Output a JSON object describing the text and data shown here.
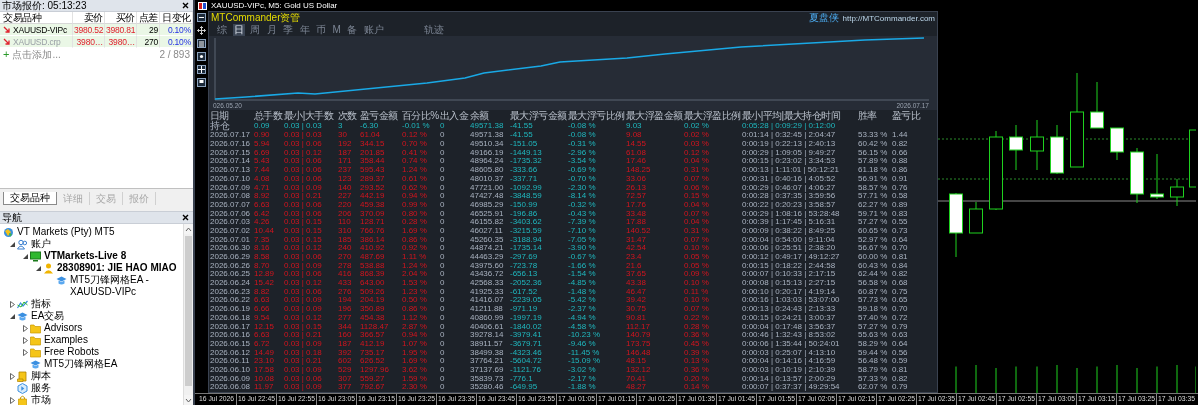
{
  "market_watch": {
    "title": "市场报价: 05:13:23",
    "columns": [
      "交易品种",
      "卖价",
      "买价",
      "点差",
      "日变化"
    ],
    "rows": [
      {
        "symbol": "XAUUSD-VIPc",
        "bid": "3980.52",
        "ask": "3980.81",
        "spread": "29",
        "change": "0.10%",
        "inactive": false
      },
      {
        "symbol": "XAUUSD.crp",
        "bid": "3980…",
        "ask": "3980…",
        "spread": "270",
        "change": "0.10%",
        "inactive": true
      }
    ],
    "add_icon": "+",
    "add_label": "点击添加...",
    "count": "2 / 893",
    "tabs": [
      {
        "label": "交易品种",
        "selected": true
      },
      {
        "label": "详细",
        "selected": false
      },
      {
        "label": "交易",
        "selected": false
      },
      {
        "label": "报价",
        "selected": false
      }
    ]
  },
  "navigator": {
    "title": "导航",
    "tree": [
      {
        "label": "VT Markets (Pty) MT5",
        "kind": "broker",
        "children": [
          {
            "label": "账户",
            "kind": "accounts",
            "expanded": true,
            "children": [
              {
                "label": "VTMarkets-Live 8",
                "kind": "server",
                "expanded": true,
                "children": [
                  {
                    "label": "28308901: JIE HAO MIAO",
                    "kind": "account",
                    "expanded": true,
                    "children": [
                      {
                        "label": "MT5刀锋网格EA - XAUUSD-VIPc",
                        "kind": "expert"
                      }
                    ]
                  }
                ]
              }
            ]
          },
          {
            "label": "指标",
            "kind": "indicators",
            "expanded": false
          },
          {
            "label": "EA交易",
            "kind": "experts",
            "expanded": true,
            "children": [
              {
                "label": "Advisors",
                "kind": "folder",
                "expanded": false
              },
              {
                "label": "Examples",
                "kind": "folder",
                "expanded": false
              },
              {
                "label": "Free Robots",
                "kind": "folder",
                "expanded": false
              },
              {
                "label": "MT5刀锋网格EA",
                "kind": "expert"
              }
            ]
          },
          {
            "label": "脚本",
            "kind": "scripts",
            "expanded": false
          },
          {
            "label": "服务",
            "kind": "services"
          },
          {
            "label": "市场",
            "kind": "market",
            "expanded": false
          }
        ]
      }
    ]
  },
  "chart_window": {
    "title": "XAUUSD-VIPc, M5: Gold US Dollar",
    "time_axis": [
      "16 Jul 2026",
      "16 Jul 22:45",
      "16 Jul 22:55",
      "16 Jul 23:05",
      "16 Jul 23:15",
      "16 Jul 23:25",
      "16 Jul 23:35",
      "16 Jul 23:45",
      "16 Jul 23:55",
      "17 Jul 01:05",
      "17 Jul 01:15",
      "17 Jul 01:25",
      "17 Jul 01:35",
      "17 Jul 01:45",
      "17 Jul 01:55",
      "17 Jul 02:05",
      "17 Jul 02:15",
      "17 Jul 02:25",
      "17 Jul 02:35",
      "17 Jul 02:45",
      "17 Jul 02:55",
      "17 Jul 03:05",
      "17 Jul 03:15",
      "17 Jul 03:25",
      "17 Jul 03:35"
    ]
  },
  "mt_commander": {
    "title": "MTCommander资管",
    "brand": "夏盘侠",
    "url": "http://MTCommander.com",
    "tabs": [
      {
        "label": "综",
        "selected": false
      },
      {
        "label": "日",
        "selected": true
      },
      {
        "label": "周",
        "selected": false
      },
      {
        "label": "月",
        "selected": false
      },
      {
        "label": "季",
        "selected": false
      },
      {
        "label": "年",
        "selected": false
      },
      {
        "label": "币",
        "selected": false
      },
      {
        "label": "M",
        "selected": false
      },
      {
        "label": "备",
        "selected": false
      },
      {
        "label": "账户",
        "selected": false
      }
    ],
    "extra_tabs": [
      {
        "label": "轨迹",
        "selected": false
      }
    ],
    "equity_curve": {
      "start_label": "026.05.20",
      "end_label": "2026.07.17"
    },
    "table": {
      "columns": [
        "日期",
        "总手数",
        "最小|大手数",
        "次数",
        "盈亏金额",
        "百分比%",
        "出入金",
        "余额",
        "最大浮亏金额",
        "最大浮亏比例",
        "最大浮盈金额",
        "最大浮盈比例",
        "最小|平均|最大持仓时间",
        "胜率",
        "盈亏比"
      ],
      "rows": [
        {
          "kind": "position",
          "cells": [
            "持仓",
            "0.09",
            "0.03 | 0.03",
            "3",
            "-6.30",
            "-0.01 %",
            "0",
            "49571.38",
            "-41.55",
            "-0.08 %",
            "9.03",
            "0.02 %",
            "0:05:28 | 0:09:29 | 0:12:00"
          ]
        },
        {
          "kind": "day",
          "cells": [
            "2026.07.17",
            "0.90",
            "0.03 | 0.03",
            "30",
            "61.04",
            "0.12 %",
            "0",
            "49571.38",
            "-41.55",
            "-0.08 %",
            "9.08",
            "0.02 %",
            "0:01:14 | 0:32:45 | 2:04:47",
            "53.33 %",
            "1.44"
          ]
        },
        {
          "kind": "day",
          "cells": [
            "2026.07.16",
            "5.94",
            "0.03 | 0.06",
            "192",
            "344.15",
            "0.70 %",
            "0",
            "49510.34",
            "-151.05",
            "-0.31 %",
            "14.55",
            "0.03 %",
            "0:00:19 | 0:22:13 | 2:40:13",
            "60.42 %",
            "0.82"
          ]
        },
        {
          "kind": "day",
          "cells": [
            "2026.07.15",
            "6.69",
            "0.03 | 0.12",
            "187",
            "201.85",
            "0.41 %",
            "0",
            "49166.19",
            "-1449.13",
            "-2.96 %",
            "61.08",
            "0.12 %",
            "0:00:29 | 1:09:05 | 9:49:27",
            "56.15 %",
            "0.66"
          ]
        },
        {
          "kind": "day",
          "cells": [
            "2026.07.14",
            "5.43",
            "0.03 | 0.06",
            "171",
            "358.44",
            "0.74 %",
            "0",
            "48964.24",
            "-1735.32",
            "-3.54 %",
            "17.46",
            "0.04 %",
            "0:00:15 | 0:23:02 | 3:34:53",
            "57.89 %",
            "0.88"
          ]
        },
        {
          "kind": "day",
          "cells": [
            "2026.07.13",
            "7.44",
            "0.03 | 0.06",
            "237",
            "595.43",
            "1.24 %",
            "0",
            "48605.80",
            "-333.66",
            "-0.69 %",
            "148.25",
            "0.31 %",
            "0:00:13 | 1:11:01 | 50:12:21",
            "61.18 %",
            "0.86"
          ]
        },
        {
          "kind": "day",
          "cells": [
            "2026.07.10",
            "4.08",
            "0.03 | 0.06",
            "123",
            "289.37",
            "0.61 %",
            "0",
            "48010.37",
            "-337.71",
            "-0.70 %",
            "33.06",
            "0.07 %",
            "0:00:31 | 0:40:16 | 4:05:52",
            "56.91 %",
            "0.91"
          ]
        },
        {
          "kind": "day",
          "cells": [
            "2026.07.09",
            "4.71",
            "0.03 | 0.09",
            "140",
            "293.52",
            "0.62 %",
            "0",
            "47721.00",
            "-1092.99",
            "-2.30 %",
            "26.13",
            "0.06 %",
            "0:00:29 | 0:46:07 | 4:06:27",
            "58.57 %",
            "0.76"
          ]
        },
        {
          "kind": "day",
          "cells": [
            "2026.07.08",
            "8.92",
            "0.03 | 0.21",
            "227",
            "442.19",
            "0.94 %",
            "0",
            "47427.48",
            "-3848.59",
            "-8.14 %",
            "72.57",
            "0.15 %",
            "0:00:28 | 0:37:35 | 3:59:56",
            "57.71 %",
            "0.58"
          ]
        },
        {
          "kind": "day",
          "cells": [
            "2026.07.07",
            "6.63",
            "0.03 | 0.06",
            "220",
            "459.38",
            "0.99 %",
            "0",
            "46985.29",
            "-150.99",
            "-0.32 %",
            "17.76",
            "0.04 %",
            "0:00:22 | 0:20:23 | 3:58:57",
            "62.27 %",
            "0.89"
          ]
        },
        {
          "kind": "day",
          "cells": [
            "2026.07.06",
            "6.42",
            "0.03 | 0.06",
            "206",
            "370.09",
            "0.80 %",
            "0",
            "46525.91",
            "-196.86",
            "-0.43 %",
            "33.48",
            "0.07 %",
            "0:00:29 | 1:08:16 | 53:28:48",
            "59.71 %",
            "0.83"
          ]
        },
        {
          "kind": "day",
          "cells": [
            "2026.07.03",
            "4.26",
            "0.03 | 0.15",
            "110",
            "128.71",
            "0.28 %",
            "0",
            "46155.82",
            "-3403.62",
            "-7.39 %",
            "17.88",
            "0.04 %",
            "0:00:39 | 1:17:45 | 5:16:31",
            "57.27 %",
            "0.55"
          ]
        },
        {
          "kind": "day",
          "cells": [
            "2026.07.02",
            "10.44",
            "0.03 | 0.15",
            "310",
            "766.76",
            "1.69 %",
            "0",
            "46027.11",
            "-3215.59",
            "-7.10 %",
            "140.52",
            "0.31 %",
            "0:00:09 | 0:38:22 | 8:49:25",
            "60.65 %",
            "0.73"
          ]
        },
        {
          "kind": "day",
          "cells": [
            "2026.07.01",
            "7.35",
            "0.03 | 0.15",
            "185",
            "386.14",
            "0.86 %",
            "0",
            "45260.35",
            "-3188.94",
            "-7.05 %",
            "31.47",
            "0.07 %",
            "0:00:04 | 0:54:00 | 9:11:04",
            "52.97 %",
            "0.64"
          ]
        },
        {
          "kind": "day",
          "cells": [
            "2026.06.30",
            "8.16",
            "0.03 | 0.12",
            "240",
            "410.92",
            "0.92 %",
            "0",
            "44874.21",
            "-1735.14",
            "-3.90 %",
            "42.54",
            "0.10 %",
            "0:00:06 | 0:25:51 | 2:38:20",
            "56.67 %",
            "0.70"
          ]
        },
        {
          "kind": "day",
          "cells": [
            "2026.06.29",
            "8.58",
            "0.03 | 0.06",
            "270",
            "487.69",
            "1.11 %",
            "0",
            "44463.29",
            "-297.69",
            "-0.67 %",
            "23.4",
            "0.05 %",
            "0:00:12 | 0:49:17 | 49:12:27",
            "60.00 %",
            "0.81"
          ]
        },
        {
          "kind": "day",
          "cells": [
            "2026.06.26",
            "8.70",
            "0.03 | 0.09",
            "278",
            "538.88",
            "1.24 %",
            "0",
            "43975.60",
            "-723.78",
            "-1.66 %",
            "21.6",
            "0.05 %",
            "0:00:15 | 0:18:22 | 2:44:58",
            "60.43 %",
            "0.84"
          ]
        },
        {
          "kind": "day",
          "cells": [
            "2026.06.25",
            "12.89",
            "0.03 | 0.06",
            "416",
            "868.39",
            "2.04 %",
            "0",
            "43436.72",
            "-656.13",
            "-1.54 %",
            "37.65",
            "0.09 %",
            "0:00:07 | 0:10:33 | 2:17:15",
            "62.44 %",
            "0.82"
          ]
        },
        {
          "kind": "day",
          "cells": [
            "2026.06.24",
            "15.42",
            "0.03 | 0.12",
            "433",
            "643.00",
            "1.53 %",
            "0",
            "42568.33",
            "-2052.36",
            "-4.85 %",
            "43.38",
            "0.10 %",
            "0:00:08 | 0:15:13 | 2:27:15",
            "56.58 %",
            "0.68"
          ]
        },
        {
          "kind": "day",
          "cells": [
            "2026.06.23",
            "8.82",
            "0.03 | 0.06",
            "276",
            "509.26",
            "1.23 %",
            "0",
            "41925.33",
            "-617.52",
            "-1.48 %",
            "46.47",
            "0.11 %",
            "0:00:10 | 0:20:17 | 4:19:14",
            "60.87 %",
            "0.75"
          ]
        },
        {
          "kind": "day",
          "cells": [
            "2026.06.22",
            "6.63",
            "0.03 | 0.09",
            "194",
            "204.19",
            "0.50 %",
            "0",
            "41416.07",
            "-2239.05",
            "-5.42 %",
            "39.42",
            "0.10 %",
            "0:00:16 | 1:03:03 | 53:07:00",
            "57.73 %",
            "0.65"
          ]
        },
        {
          "kind": "day",
          "cells": [
            "2026.06.19",
            "6.66",
            "0.03 | 0.09",
            "196",
            "350.89",
            "0.86 %",
            "0",
            "41211.88",
            "-971.19",
            "-2.37 %",
            "30.75",
            "0.07 %",
            "0:00:13 | 0:24:43 | 2:13:33",
            "59.18 %",
            "0.70"
          ]
        },
        {
          "kind": "day",
          "cells": [
            "2026.06.18",
            "9.54",
            "0.03 | 0.12",
            "277",
            "454.38",
            "1.12 %",
            "0",
            "40860.99",
            "-1997.19",
            "-4.94 %",
            "90.81",
            "0.22 %",
            "0:00:15 | 0:24:21 | 3:00:37",
            "57.40 %",
            "0.72"
          ]
        },
        {
          "kind": "day",
          "cells": [
            "2026.06.17",
            "12.15",
            "0.03 | 0.15",
            "344",
            "1128.47",
            "2.87 %",
            "0",
            "40406.61",
            "-1840.02",
            "-4.58 %",
            "112.17",
            "0.28 %",
            "0:00:04 | 0:17:48 | 3:56:37",
            "57.27 %",
            "0.79"
          ]
        },
        {
          "kind": "day",
          "cells": [
            "2026.06.16",
            "6.63",
            "0.03 | 0.21",
            "160",
            "366.57",
            "0.94 %",
            "0",
            "39278.14",
            "-3979.41",
            "-10.23 %",
            "140.79",
            "0.36 %",
            "0:00:46 | 1:32:43 | 8:53:02",
            "55.63 %",
            "0.63"
          ]
        },
        {
          "kind": "day",
          "cells": [
            "2026.06.15",
            "6.72",
            "0.03 | 0.09",
            "187",
            "412.19",
            "1.07 %",
            "0",
            "38911.57",
            "-3679.71",
            "-9.46 %",
            "173.75",
            "0.45 %",
            "0:00:06 | 1:35:44 | 50:24:01",
            "58.29 %",
            "0.64"
          ]
        },
        {
          "kind": "day",
          "cells": [
            "2026.06.12",
            "14.49",
            "0.03 | 0.18",
            "392",
            "735.17",
            "1.95 %",
            "0",
            "38499.38",
            "-4323.46",
            "-11.45 %",
            "146.48",
            "0.39 %",
            "0:00:03 | 0:25:07 | 4:13:10",
            "59.44 %",
            "0.56"
          ]
        },
        {
          "kind": "day",
          "cells": [
            "2026.06.11",
            "23.10",
            "0.03 | 0.21",
            "602",
            "626.52",
            "1.69 %",
            "0",
            "37764.21",
            "-5604.72",
            "-15.09 %",
            "48.15",
            "0.13 %",
            "0:00:04 | 0:14:16 | 4:16:59",
            "56.48 %",
            "0.59"
          ]
        },
        {
          "kind": "day",
          "cells": [
            "2026.06.10",
            "17.58",
            "0.03 | 0.09",
            "529",
            "1297.96",
            "3.62 %",
            "0",
            "37137.69",
            "-1121.76",
            "-3.02 %",
            "132.12",
            "0.36 %",
            "0:00:03 | 0:10:19 | 2:10:39",
            "58.79 %",
            "0.81"
          ]
        },
        {
          "kind": "day",
          "cells": [
            "2026.06.09",
            "10.08",
            "0.03 | 0.06",
            "307",
            "559.27",
            "1.59 %",
            "0",
            "35839.73",
            "-776.1",
            "-2.17 %",
            "70.41",
            "0.20 %",
            "0:00:14 | 0:13:57 | 2:00:29",
            "57.33 %",
            "0.82"
          ]
        },
        {
          "kind": "day",
          "cells": [
            "2026.06.08",
            "11.97",
            "0.03 | 0.09",
            "377",
            "792.67",
            "2.30 %",
            "0",
            "35280.46",
            "-649.95",
            "-1.88 %",
            "48.27",
            "0.14 %",
            "0:00:07 | 0:37:37 | 49:29:54",
            "62.07 %",
            "0.79"
          ]
        }
      ]
    }
  }
}
